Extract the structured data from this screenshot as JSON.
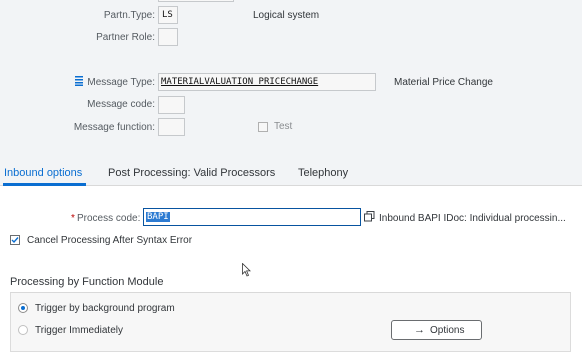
{
  "header": {
    "partner_type_label": "Partn.Type:",
    "partner_type_value": "LS",
    "partner_type_desc": "Logical system",
    "partner_role_label": "Partner Role:",
    "partner_role_value": "",
    "message_type_label": "Message Type:",
    "message_type_value": "MATERIALVALUATION_PRICECHANGE",
    "message_type_desc": "Material Price Change",
    "message_code_label": "Message code:",
    "message_code_value": "",
    "message_function_label": "Message function:",
    "message_function_value": "",
    "test_label": "Test",
    "test_checked": false
  },
  "tabs": [
    {
      "label": "Inbound options",
      "active": true
    },
    {
      "label": "Post Processing: Valid Processors",
      "active": false
    },
    {
      "label": "Telephony",
      "active": false
    }
  ],
  "inbound": {
    "required_marker": "*",
    "process_code_label": "Process code:",
    "process_code_value": "BAPI",
    "process_code_desc": "Inbound BAPI IDoc: Individual processin...",
    "cancel_processing_label": "Cancel Processing After Syntax Error",
    "cancel_processing_checked": true
  },
  "processing": {
    "title": "Processing by Function Module",
    "options": [
      {
        "label": "Trigger by background program",
        "selected": true
      },
      {
        "label": "Trigger Immediately",
        "selected": false
      }
    ],
    "options_button_label": "Options"
  },
  "colors": {
    "accent": "#0a6ed1",
    "required": "#bb0000"
  }
}
